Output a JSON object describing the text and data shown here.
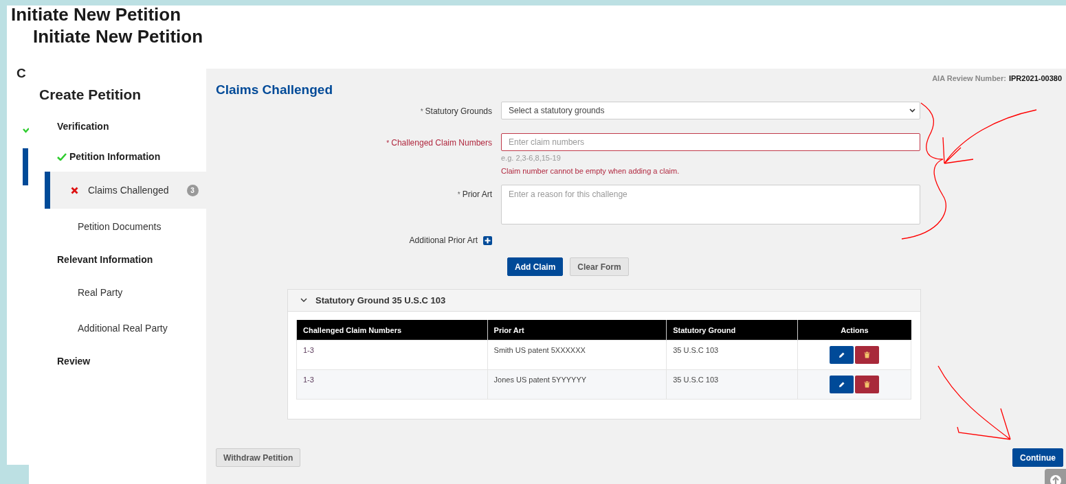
{
  "back_layer": {
    "titles": [
      "Initiate New Petition",
      "Initiate New Petition"
    ],
    "clipped_heading": "C",
    "step_done": true
  },
  "sidebar": {
    "title": "Create Petition",
    "items": [
      {
        "label": "Verification",
        "kind": "section",
        "done": false,
        "error": false,
        "selected": false
      },
      {
        "label": "Petition Information",
        "kind": "section",
        "done": true,
        "error": false,
        "selected": false
      },
      {
        "label": "Claims Challenged",
        "kind": "sub",
        "done": false,
        "error": true,
        "selected": true,
        "badge": "3"
      },
      {
        "label": "Petition Documents",
        "kind": "sub",
        "done": false,
        "error": false,
        "selected": false
      },
      {
        "label": "Relevant Information",
        "kind": "section",
        "done": false,
        "error": false,
        "selected": false
      },
      {
        "label": "Real Party",
        "kind": "sub",
        "done": false,
        "error": false,
        "selected": false
      },
      {
        "label": "Additional Real Party",
        "kind": "sub",
        "done": false,
        "error": false,
        "selected": false
      },
      {
        "label": "Review",
        "kind": "section",
        "done": false,
        "error": false,
        "selected": false
      }
    ]
  },
  "review_number": {
    "label": "AIA Review Number:",
    "value": "IPR2021-00380"
  },
  "form": {
    "title": "Claims Challenged",
    "fields": [
      {
        "label": "Statutory Grounds",
        "required": "*",
        "kind": "select",
        "placeholder": "Select a statutory grounds",
        "error": false
      },
      {
        "label": "Challenged Claim Numbers",
        "required": "*",
        "kind": "text",
        "placeholder": "Enter claim numbers",
        "error": true,
        "hint": "e.g. 2,3-6,8,15-19",
        "error_message": "Claim number cannot be empty when adding a claim."
      },
      {
        "label": "Prior Art",
        "required": "*",
        "kind": "textarea",
        "placeholder": "Enter a reason for this challenge",
        "error": false
      }
    ],
    "additional": {
      "label": "Additional Prior Art"
    },
    "buttons": [
      {
        "label": "Add Claim",
        "kind": "primary"
      },
      {
        "label": "Clear Form",
        "kind": "secondary"
      }
    ]
  },
  "ground_panel": {
    "title": "Statutory Ground 35 U.S.C 103",
    "expanded": true,
    "table": {
      "columns": [
        "Challenged Claim Numbers",
        "Prior Art",
        "Statutory Ground",
        "Actions"
      ],
      "rows": [
        {
          "cells": [
            "1-3",
            "Smith US patent 5XXXXXX",
            "35 U.S.C 103"
          ]
        },
        {
          "cells": [
            "1-3",
            "Jones US patent 5YYYYYY",
            "35 U.S.C 103"
          ]
        }
      ]
    }
  },
  "footer": {
    "buttons": [
      {
        "label": "Withdraw Petition",
        "kind": "secondary"
      },
      {
        "label": "Continue",
        "kind": "primary"
      }
    ]
  }
}
